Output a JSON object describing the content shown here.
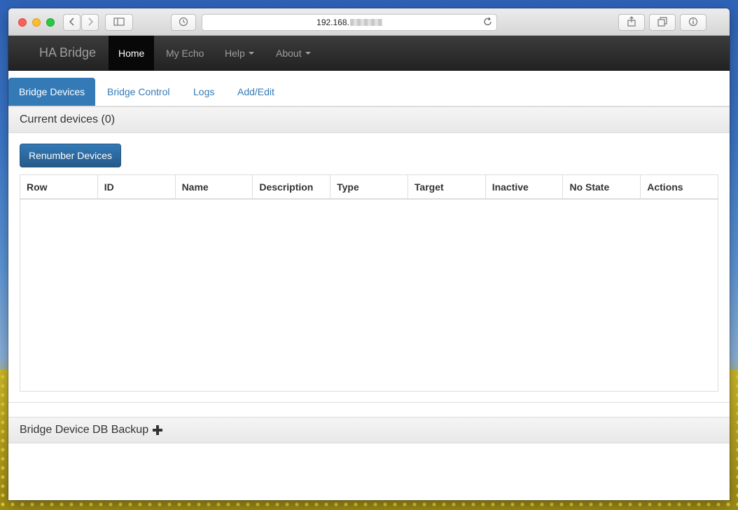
{
  "browser": {
    "address_text": "192.168."
  },
  "navbar": {
    "brand": "HA Bridge",
    "items": [
      {
        "label": "Home",
        "active": true
      },
      {
        "label": "My Echo"
      },
      {
        "label": "Help"
      },
      {
        "label": "About"
      }
    ]
  },
  "tabs": [
    {
      "label": "Bridge Devices",
      "active": true
    },
    {
      "label": "Bridge Control"
    },
    {
      "label": "Logs"
    },
    {
      "label": "Add/Edit"
    }
  ],
  "devices_panel": {
    "title": "Current devices (0)",
    "renumber_label": "Renumber Devices",
    "columns": [
      "Row",
      "ID",
      "Name",
      "Description",
      "Type",
      "Target",
      "Inactive",
      "No State",
      "Actions"
    ]
  },
  "backup_panel": {
    "title": "Bridge Device DB Backup"
  },
  "colors": {
    "accent": "#337ab7",
    "navbar": "#222222"
  }
}
